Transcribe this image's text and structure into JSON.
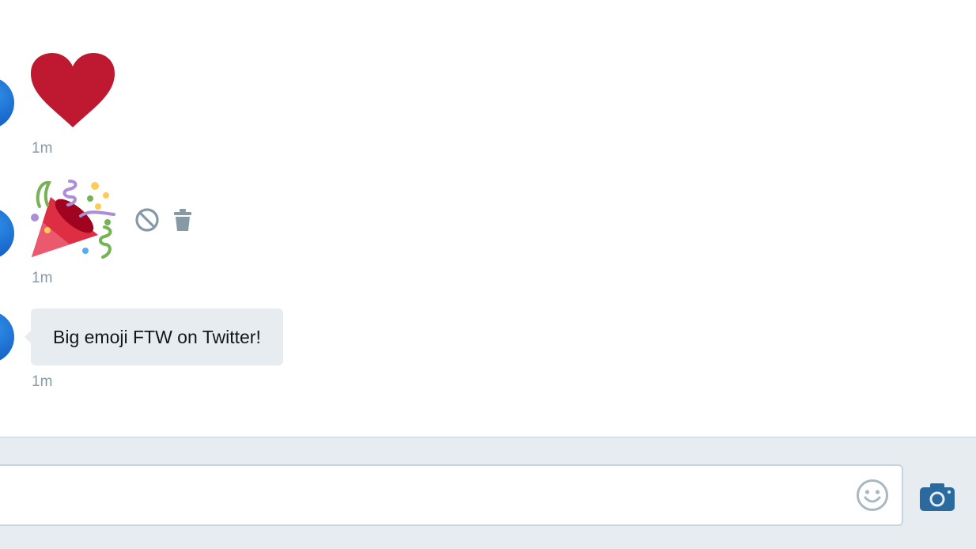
{
  "messages": [
    {
      "type": "emoji",
      "emoji": "heart-icon",
      "time": "1m"
    },
    {
      "type": "emoji",
      "emoji": "party-popper-icon",
      "time": "1m",
      "actions": [
        "block-icon",
        "trash-icon"
      ]
    },
    {
      "type": "text",
      "text": "Big emoji FTW on Twitter!",
      "time": "1m"
    }
  ],
  "composer": {
    "value": "",
    "placeholder": "",
    "icons": [
      "smiley-icon",
      "camera-icon"
    ]
  },
  "colors": {
    "bubble": "#e6ecf0",
    "timestamp": "#8899a6",
    "accent": "#1b95e0",
    "camera": "#2b6a9e",
    "heart": "#be1931",
    "composer_bg": "#e6ecf0"
  }
}
